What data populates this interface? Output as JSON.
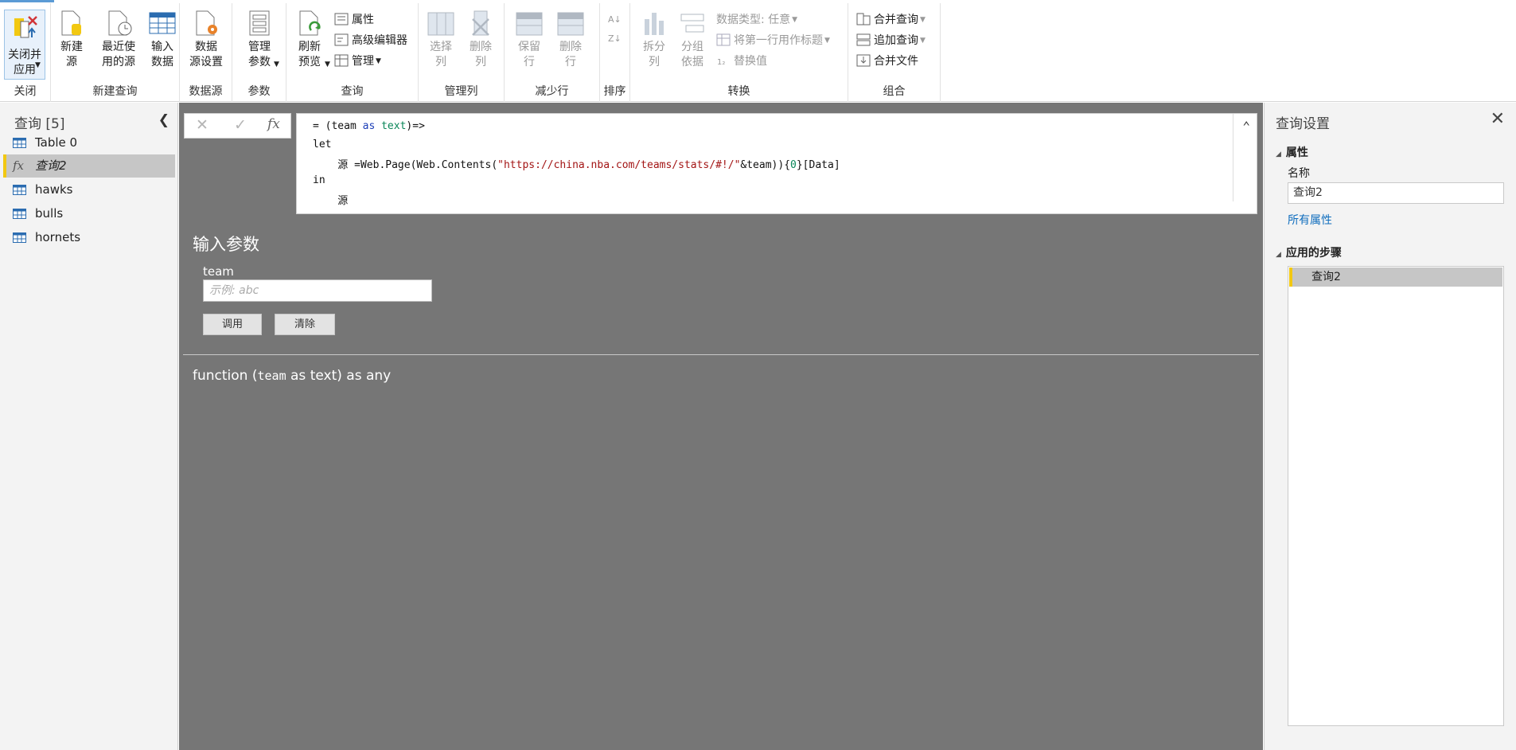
{
  "ribbon": {
    "groups": {
      "close": "关闭",
      "new_query": "新建查询",
      "data_source": "数据源",
      "params": "参数",
      "query": "查询",
      "manage_cols": "管理列",
      "reduce_rows": "减少行",
      "sort": "排序",
      "transform": "转换",
      "combine": "组合"
    },
    "buttons": {
      "close_apply": "关闭并\n应用",
      "new_source": "新建\n源",
      "recent_sources": "最近使\n用的源",
      "enter_data": "输入\n数据",
      "data_source_settings": "数据\n源设置",
      "manage_params": "管理\n参数",
      "refresh_preview": "刷新\n预览",
      "properties": "属性",
      "advanced_editor": "高级编辑器",
      "manage": "管理",
      "choose_cols": "选择\n列",
      "remove_cols": "删除\n列",
      "keep_rows": "保留\n行",
      "remove_rows": "删除\n行",
      "split_col": "拆分\n列",
      "group_by": "分组\n依据",
      "data_type": "数据类型: 任意",
      "first_row_header": "将第一行用作标题",
      "replace_values": "替换值",
      "merge_queries": "合并查询",
      "append_queries": "追加查询",
      "combine_files": "合并文件"
    }
  },
  "left": {
    "header": "查询 [5]",
    "queries": [
      {
        "label": "Table 0",
        "icon": "table-icon"
      },
      {
        "label": "查询2",
        "icon": "function-icon",
        "selected": true
      },
      {
        "label": "hawks",
        "icon": "table-icon"
      },
      {
        "label": "bulls",
        "icon": "table-icon"
      },
      {
        "label": "hornets",
        "icon": "table-icon"
      }
    ]
  },
  "formula": {
    "fx": "fx",
    "line1_a": "= (team ",
    "line1_kw": "as",
    "line1_b": " ",
    "line1_type": "text",
    "line1_c": ")=>",
    "line2": "let",
    "line3_a": "    源 =Web.Page(Web.Contents(",
    "line3_str": "\"https://china.nba.com/teams/stats/#!/\"",
    "line3_b": "&team)){",
    "line3_num": "0",
    "line3_c": "}[Data]",
    "line4": "in",
    "line5": "    源"
  },
  "invoke": {
    "title": "输入参数",
    "param_label": "team",
    "placeholder": "示例: abc",
    "invoke_btn": "调用",
    "clear_btn": "清除",
    "sig_a": "function (",
    "sig_mono": "team",
    "sig_b": " as text) as any"
  },
  "right": {
    "header": "查询设置",
    "properties": "属性",
    "name_label": "名称",
    "name_value": "查询2",
    "all_props": "所有属性",
    "applied_steps": "应用的步骤",
    "steps": [
      "查询2"
    ]
  },
  "colors": {
    "accent": "#f2c811",
    "main_bg": "#767676",
    "link": "#106ebe"
  }
}
